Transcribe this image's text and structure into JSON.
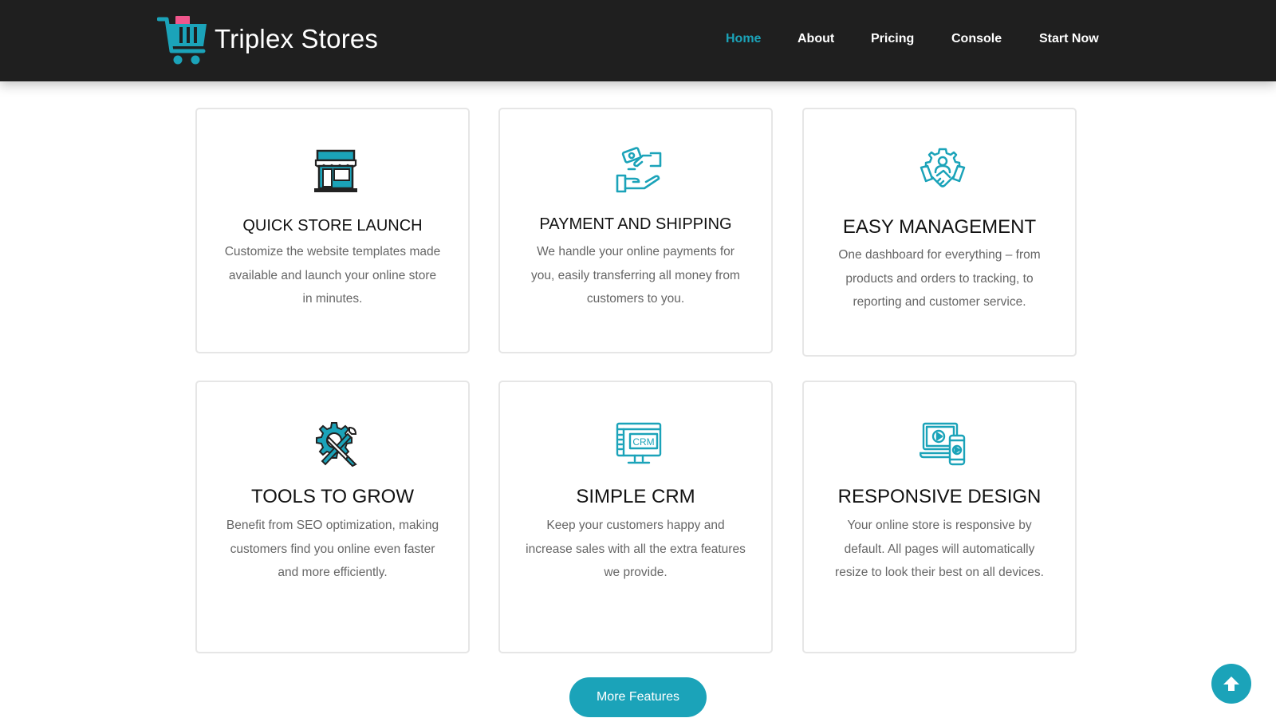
{
  "brand": {
    "name": "Triplex Stores",
    "logo_icon": "shopping-cart-logo-icon"
  },
  "nav": {
    "items": [
      {
        "label": "Home",
        "active": true
      },
      {
        "label": "About",
        "active": false
      },
      {
        "label": "Pricing",
        "active": false
      },
      {
        "label": "Console",
        "active": false
      },
      {
        "label": "Start Now",
        "active": false
      }
    ]
  },
  "colors": {
    "accent": "#1ba3b9",
    "header_bg": "#1f1f1f",
    "logo_pink": "#f0568c"
  },
  "features": [
    {
      "icon": "storefront-icon",
      "title": "QUICK STORE LAUNCH",
      "desc": "Customize the website templates made available and launch your online store in minutes."
    },
    {
      "icon": "payment-handshake-icon",
      "title": "PAYMENT AND SHIPPING",
      "desc": "We handle your online payments for you, easily transferring all money from customers to you."
    },
    {
      "icon": "management-handshake-gear-icon",
      "title": "EASY MANAGEMENT",
      "desc": "One dashboard for everything – from products and orders to tracking, to reporting and customer service."
    },
    {
      "icon": "tools-gear-icon",
      "title": "TOOLS TO GROW",
      "desc": "Benefit from SEO optimization, making customers find you online even faster and more efficiently."
    },
    {
      "icon": "crm-monitor-icon",
      "title": "SIMPLE CRM",
      "desc": "Keep your customers happy and increase sales with all the extra features we provide."
    },
    {
      "icon": "responsive-devices-icon",
      "title": "RESPONSIVE DESIGN",
      "desc": "Your online store is responsive by default. All pages will automatically resize to look their best on all devices."
    }
  ],
  "more_button": {
    "label": "More Features"
  },
  "scroll_top": {
    "icon": "arrow-up-icon"
  }
}
